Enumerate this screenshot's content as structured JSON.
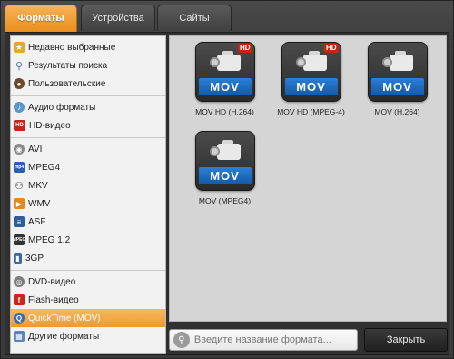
{
  "tabs": [
    {
      "label": "Форматы",
      "active": true
    },
    {
      "label": "Устройства",
      "active": false
    },
    {
      "label": "Сайты",
      "active": false
    }
  ],
  "sidebar": {
    "groups": [
      [
        {
          "label": "Недавно выбранные",
          "icon": "star-icon",
          "glyph": "★"
        },
        {
          "label": "Результаты поиска",
          "icon": "search-icon",
          "glyph": "⚲"
        },
        {
          "label": "Пользовательские",
          "icon": "user-icon",
          "glyph": "●"
        }
      ],
      [
        {
          "label": "Аудио форматы",
          "icon": "audio-icon",
          "glyph": "♪"
        },
        {
          "label": "HD-видео",
          "icon": "hd-icon",
          "glyph": "HD"
        }
      ],
      [
        {
          "label": "AVI",
          "icon": "avi-icon",
          "glyph": "◉"
        },
        {
          "label": "MPEG4",
          "icon": "mp4-icon",
          "glyph": "mp4"
        },
        {
          "label": "MKV",
          "icon": "mkv-icon",
          "glyph": "⚇"
        },
        {
          "label": "WMV",
          "icon": "wmv-icon",
          "glyph": "▶"
        },
        {
          "label": "ASF",
          "icon": "asf-icon",
          "glyph": "≡"
        },
        {
          "label": "MPEG 1,2",
          "icon": "mpeg-icon",
          "glyph": "MPEG"
        },
        {
          "label": "3GP",
          "icon": "phone-icon",
          "glyph": "▮"
        }
      ],
      [
        {
          "label": "DVD-видео",
          "icon": "dvd-icon",
          "glyph": "◎"
        },
        {
          "label": "Flash-видео",
          "icon": "flash-icon",
          "glyph": "f"
        },
        {
          "label": "QuickTime (MOV)",
          "icon": "quicktime-icon",
          "glyph": "Q",
          "selected": true
        },
        {
          "label": "Другие форматы",
          "icon": "other-formats-icon",
          "glyph": "▦"
        }
      ]
    ]
  },
  "formats": [
    {
      "label": "MOV HD (H.264)",
      "badge": "MOV",
      "hd": "HD"
    },
    {
      "label": "MOV HD (MPEG-4)",
      "badge": "MOV",
      "hd": "HD"
    },
    {
      "label": "MOV (H.264)",
      "badge": "MOV",
      "hd": ""
    },
    {
      "label": "MOV (MPEG4)",
      "badge": "MOV",
      "hd": ""
    }
  ],
  "search": {
    "placeholder": "Введите название формата..."
  },
  "close_button": {
    "label": "Закрыть"
  },
  "colors": {
    "accent": "#ef9a2d",
    "mov_blue": "#1f6fc4",
    "hd_red": "#c8231a"
  }
}
